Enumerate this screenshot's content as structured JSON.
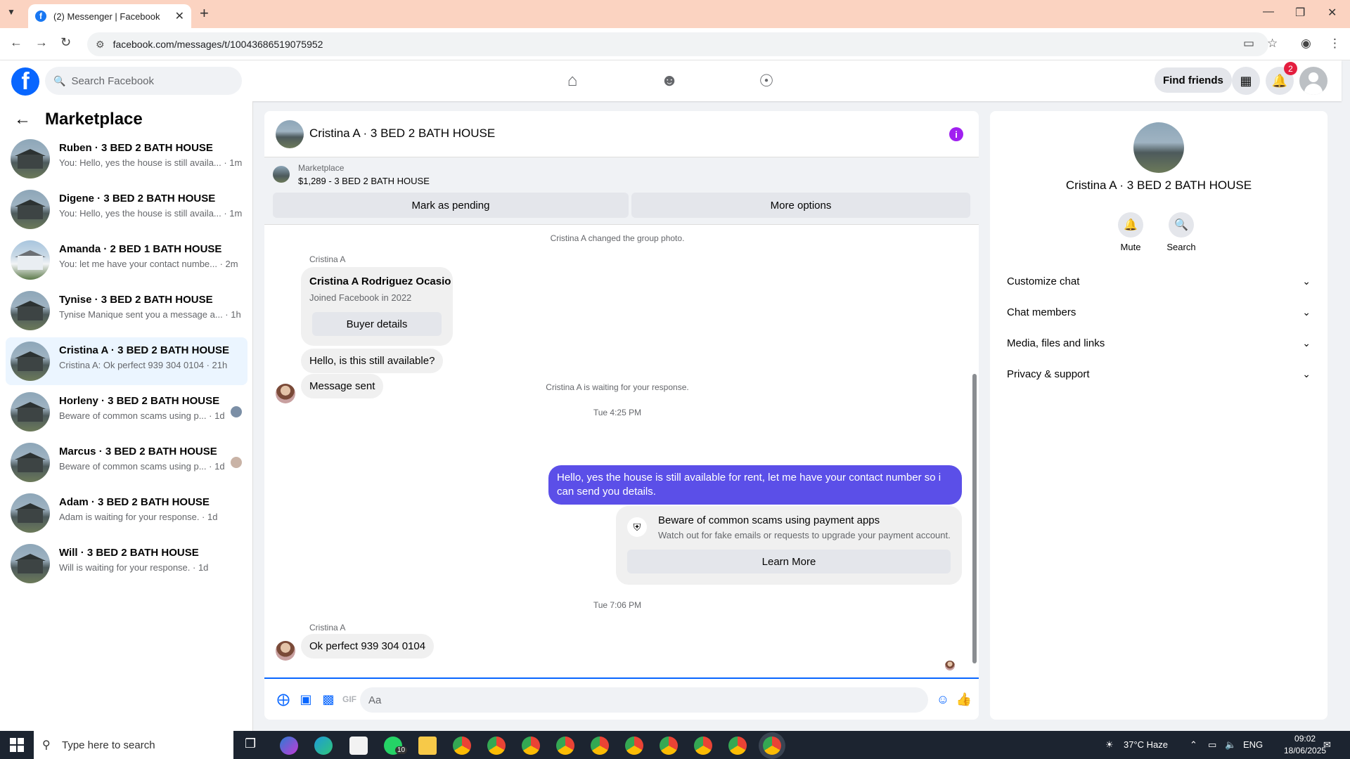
{
  "browser": {
    "tab_title": "(2) Messenger | Facebook",
    "url": "facebook.com/messages/t/10043686519075952"
  },
  "fbnav": {
    "search_placeholder": "Search Facebook",
    "find_friends": "Find friends",
    "notification_count": "2"
  },
  "sidebar": {
    "title": "Marketplace",
    "conversations": [
      {
        "name": "Ruben · 3 BED 2 BATH HOUSE",
        "preview": "You: Hello, yes the house is still availa... · 1m"
      },
      {
        "name": "Digene · 3 BED 2 BATH HOUSE",
        "preview": "You: Hello, yes the house is still availa... · 1m"
      },
      {
        "name": "Amanda · 2 BED 1 BATH HOUSE",
        "preview": "You: let me have your contact numbe... · 2m"
      },
      {
        "name": "Tynise · 3 BED 2 BATH HOUSE",
        "preview": "Tynise Manique sent you a message a... · 1h"
      },
      {
        "name": "Cristina A · 3 BED 2 BATH HOUSE",
        "preview": "Cristina A: Ok perfect 939 304 0104 · 21h"
      },
      {
        "name": "Horleny · 3 BED 2 BATH HOUSE",
        "preview": "Beware of common scams using p... · 1d"
      },
      {
        "name": "Marcus · 3 BED 2 BATH HOUSE",
        "preview": "Beware of common scams using p... · 1d"
      },
      {
        "name": "Adam · 3 BED 2 BATH HOUSE",
        "preview": "Adam is waiting for your response. · 1d"
      },
      {
        "name": "Will · 3 BED 2 BATH HOUSE",
        "preview": "Will is waiting for your response. · 1d"
      }
    ]
  },
  "chat": {
    "title": "Cristina A · 3 BED 2 BATH HOUSE",
    "marketplace_label": "Marketplace",
    "listing": "$1,289 - 3 BED 2 BATH HOUSE",
    "mark_pending": "Mark as pending",
    "more_options": "More options",
    "sys_group_photo": "Cristina A changed the group photo.",
    "sender_name": "Cristina A",
    "card_name": "Cristina A Rodriguez Ocasio",
    "card_joined": "Joined Facebook in 2022",
    "card_button": "Buyer details",
    "msg_available": "Hello, is this still available?",
    "msg_sent": "Message sent",
    "sys_waiting": "Cristina A is waiting for your response.",
    "time_1": "Tue 4:25 PM",
    "out_message": "Hello, yes the house is still available for rent, let me have your contact number so i can send you details.",
    "scam_title": "Beware of common scams using payment apps",
    "scam_desc": "Watch out for fake emails or requests to upgrade your payment account.",
    "scam_button": "Learn More",
    "time_2": "Tue 7:06 PM",
    "sender_name_2": "Cristina A",
    "last_message": "Ok perfect 939 304 0104",
    "composer_placeholder": "Aa"
  },
  "info_panel": {
    "name": "Cristina A · 3 BED 2 BATH HOUSE",
    "mute": "Mute",
    "search": "Search",
    "rows": [
      "Customize chat",
      "Chat members",
      "Media, files and links",
      "Privacy & support"
    ]
  },
  "taskbar": {
    "search_placeholder": "Type here to search",
    "weather": "37°C  Haze",
    "lang": "ENG",
    "time": "09:02",
    "date": "18/06/2025",
    "whatsapp_badge": "10"
  }
}
